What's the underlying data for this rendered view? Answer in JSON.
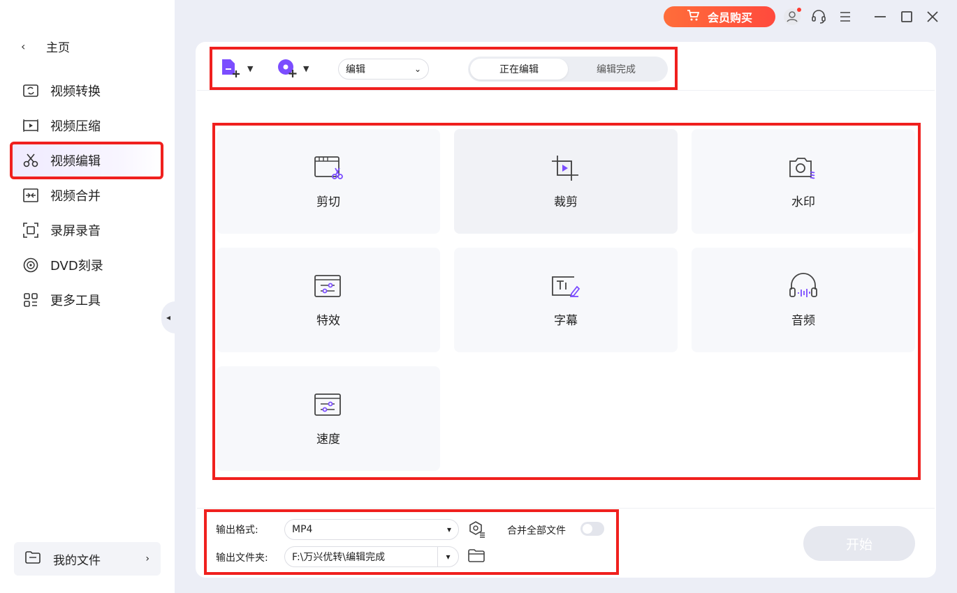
{
  "sidebar": {
    "home_label": "主页",
    "items": [
      {
        "label": "视频转换",
        "icon": "video-convert-icon"
      },
      {
        "label": "视频压缩",
        "icon": "video-compress-icon"
      },
      {
        "label": "视频编辑",
        "icon": "scissors-icon",
        "active": true
      },
      {
        "label": "视频合并",
        "icon": "video-merge-icon"
      },
      {
        "label": "录屏录音",
        "icon": "screen-record-icon"
      },
      {
        "label": "DVD刻录",
        "icon": "dvd-icon"
      },
      {
        "label": "更多工具",
        "icon": "more-tools-icon"
      }
    ],
    "my_files_label": "我的文件"
  },
  "titlebar": {
    "vip_label": "会员购买"
  },
  "toolbar": {
    "edit_select_value": "编辑",
    "tab_editing": "正在编辑",
    "tab_done": "编辑完成"
  },
  "tools": [
    {
      "label": "剪切",
      "icon": "cut-icon"
    },
    {
      "label": "裁剪",
      "icon": "crop-icon"
    },
    {
      "label": "水印",
      "icon": "watermark-icon"
    },
    {
      "label": "特效",
      "icon": "effects-icon"
    },
    {
      "label": "字幕",
      "icon": "subtitle-icon"
    },
    {
      "label": "音频",
      "icon": "audio-icon"
    },
    {
      "label": "速度",
      "icon": "speed-icon"
    }
  ],
  "output": {
    "format_label": "输出格式:",
    "format_value": "MP4",
    "merge_label": "合并全部文件",
    "folder_label": "输出文件夹:",
    "folder_value": "F:\\万兴优转\\编辑完成",
    "start_label": "开始"
  },
  "colors": {
    "accent": "#7b4dff",
    "highlight": "#f0201e",
    "vip": "#ff5a3c"
  }
}
